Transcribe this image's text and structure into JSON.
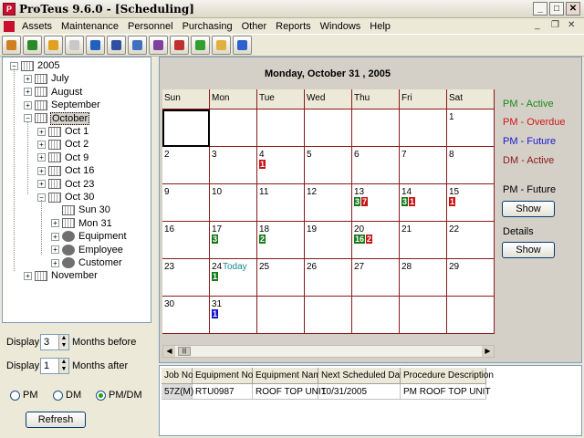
{
  "window": {
    "app_glyph": "P",
    "title": "ProTeus 9.6.0 - [Scheduling]",
    "min": "_",
    "max": "□",
    "close": "✕"
  },
  "mdi": {
    "min": "_",
    "restore": "❐",
    "close": "✕"
  },
  "menu": [
    "Assets",
    "Maintenance",
    "Personnel",
    "Purchasing",
    "Other",
    "Reports",
    "Windows",
    "Help"
  ],
  "toolbar": [
    {
      "name": "assets-icon",
      "color": "#d08020"
    },
    {
      "name": "maintenance-icon",
      "color": "#2a8a2a"
    },
    {
      "name": "workorder-icon",
      "color": "#e0a020"
    },
    {
      "name": "report-icon",
      "color": "#c8c8c8"
    },
    {
      "name": "search-icon",
      "color": "#2060c0"
    },
    {
      "name": "schedule-icon",
      "color": "#3050a0"
    },
    {
      "name": "calendar-icon",
      "color": "#4070c0"
    },
    {
      "name": "personnel-icon",
      "color": "#8040a0"
    },
    {
      "name": "user-icon",
      "color": "#c03030"
    },
    {
      "name": "tools-icon",
      "color": "#30a030"
    },
    {
      "name": "documents-icon",
      "color": "#e0b040"
    },
    {
      "name": "help-icon",
      "color": "#3060d0"
    }
  ],
  "tree": {
    "root": "2005",
    "months": [
      "July",
      "August",
      "September",
      "October"
    ],
    "weeks": [
      "Oct 1",
      "Oct 2",
      "Oct 9",
      "Oct 16",
      "Oct 23",
      "Oct 30"
    ],
    "days": [
      "Sun 30",
      "Mon 31"
    ],
    "groups": [
      "Equipment",
      "Employee",
      "Customer"
    ],
    "last": "November"
  },
  "left": {
    "display_label": "Display",
    "months_before": "3",
    "months_before_label": "Months before",
    "months_after": "1",
    "months_after_label": "Months after",
    "radios": [
      {
        "label": "PM",
        "on": false
      },
      {
        "label": "DM",
        "on": false
      },
      {
        "label": "PM/DM",
        "on": true
      }
    ],
    "refresh": "Refresh"
  },
  "calendar": {
    "title": "Monday, October 31 , 2005",
    "days": [
      "Sun",
      "Mon",
      "Tue",
      "Wed",
      "Thu",
      "Fri",
      "Sat"
    ],
    "today_label": "Today",
    "weeks": [
      [
        {
          "d": ""
        },
        {
          "d": ""
        },
        {
          "d": ""
        },
        {
          "d": ""
        },
        {
          "d": ""
        },
        {
          "d": ""
        },
        {
          "d": "1"
        }
      ],
      [
        {
          "d": "2"
        },
        {
          "d": "3"
        },
        {
          "d": "4",
          "b": [
            [
              "1",
              "od"
            ]
          ]
        },
        {
          "d": "5"
        },
        {
          "d": "6"
        },
        {
          "d": "7"
        },
        {
          "d": "8"
        }
      ],
      [
        {
          "d": "9"
        },
        {
          "d": "10"
        },
        {
          "d": "11"
        },
        {
          "d": "12"
        },
        {
          "d": "13",
          "b": [
            [
              "3",
              "pm"
            ],
            [
              "7",
              "od"
            ]
          ]
        },
        {
          "d": "14",
          "b": [
            [
              "3",
              "pm"
            ],
            [
              "1",
              "od"
            ]
          ]
        },
        {
          "d": "15",
          "b": [
            [
              "1",
              "od"
            ]
          ]
        }
      ],
      [
        {
          "d": "16"
        },
        {
          "d": "17",
          "b": [
            [
              "3",
              "pm"
            ]
          ]
        },
        {
          "d": "18",
          "b": [
            [
              "2",
              "pm"
            ]
          ]
        },
        {
          "d": "19"
        },
        {
          "d": "20",
          "b": [
            [
              "16",
              "pm"
            ],
            [
              "2",
              "od"
            ]
          ]
        },
        {
          "d": "21"
        },
        {
          "d": "22"
        }
      ],
      [
        {
          "d": "23"
        },
        {
          "d": "24",
          "today": true,
          "b": [
            [
              "1",
              "pm"
            ]
          ]
        },
        {
          "d": "25"
        },
        {
          "d": "26"
        },
        {
          "d": "27"
        },
        {
          "d": "28"
        },
        {
          "d": "29"
        }
      ],
      [
        {
          "d": "30"
        },
        {
          "d": "31",
          "b": [
            [
              "1",
              "fu"
            ]
          ]
        },
        {
          "d": ""
        },
        {
          "d": ""
        },
        {
          "d": ""
        },
        {
          "d": ""
        },
        {
          "d": ""
        }
      ]
    ],
    "scroll_left": "◀",
    "scroll_right": "▶",
    "scroll_grip": "|||"
  },
  "legend": {
    "pm_active": {
      "label": "PM - Active",
      "color": "#1a8a1a"
    },
    "pm_overdue": {
      "label": "PM - Overdue",
      "color": "#d01818"
    },
    "pm_future": {
      "label": "PM - Future",
      "color": "#1818d0"
    },
    "dm_active": {
      "label": "DM - Active",
      "color": "#8b1a1a"
    },
    "pm_future_show_label": "PM - Future",
    "details_label": "Details",
    "show": "Show"
  },
  "jobs": {
    "headers": [
      "Job No.",
      "Equipment No.",
      "Equipment Name",
      "Next Scheduled Date",
      "Procedure Description"
    ],
    "rows": [
      [
        "57Z(M)",
        "RTU0987",
        "ROOF TOP UNIT",
        "10/31/2005",
        "PM ROOF TOP UNIT"
      ]
    ]
  }
}
